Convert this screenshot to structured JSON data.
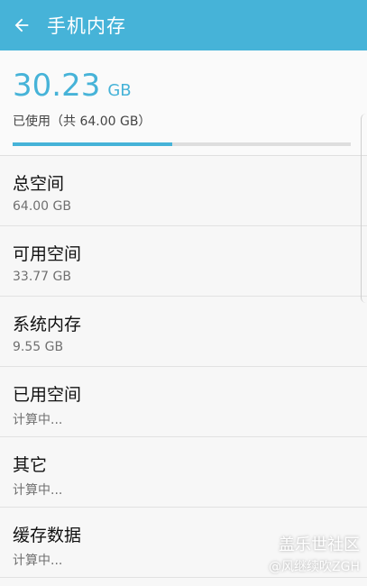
{
  "app_bar": {
    "title": "手机内存",
    "back_icon": "arrow-left-icon",
    "color": "#46b3d8"
  },
  "summary": {
    "used_value": "30.23",
    "used_unit": "GB",
    "subtitle": "已使用（共 64.00 GB）",
    "progress_fraction": 0.472
  },
  "items": [
    {
      "label": "总空间",
      "value": "64.00 GB"
    },
    {
      "label": "可用空间",
      "value": "33.77 GB"
    },
    {
      "label": "系统内存",
      "value": "9.55 GB"
    },
    {
      "label": "已用空间",
      "value": "计算中..."
    },
    {
      "label": "其它",
      "value": "计算中..."
    },
    {
      "label": "缓存数据",
      "value": "计算中..."
    }
  ],
  "watermark": {
    "line1": "盖乐世社区",
    "line2": "@风继续吹ZGH"
  }
}
